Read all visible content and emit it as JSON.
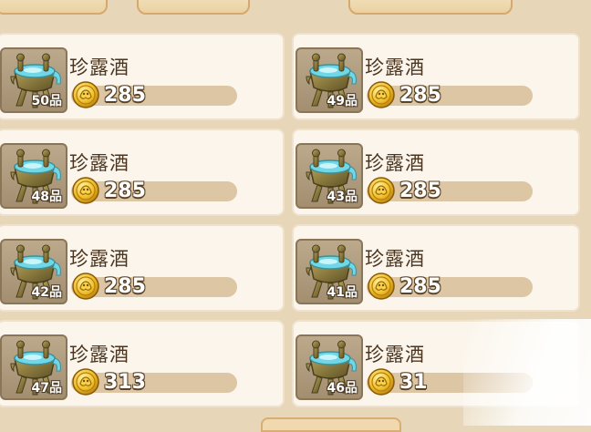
{
  "items": [
    {
      "name": "珍露酒",
      "grade": "50品",
      "price": "285"
    },
    {
      "name": "珍露酒",
      "grade": "49品",
      "price": "285"
    },
    {
      "name": "珍露酒",
      "grade": "48品",
      "price": "285"
    },
    {
      "name": "珍露酒",
      "grade": "43品",
      "price": "285"
    },
    {
      "name": "珍露酒",
      "grade": "42品",
      "price": "285"
    },
    {
      "name": "珍露酒",
      "grade": "41品",
      "price": "285"
    },
    {
      "name": "珍露酒",
      "grade": "47品",
      "price": "313"
    },
    {
      "name": "珍露酒",
      "grade": "46品",
      "price": "31"
    }
  ],
  "colors": {
    "coin": "#e6b422",
    "water": "#6fd7e6",
    "bronze": "#8a7a3e"
  },
  "icons": {
    "item": "bronze-wine-vessel-icon",
    "currency": "gold-coin-icon"
  }
}
